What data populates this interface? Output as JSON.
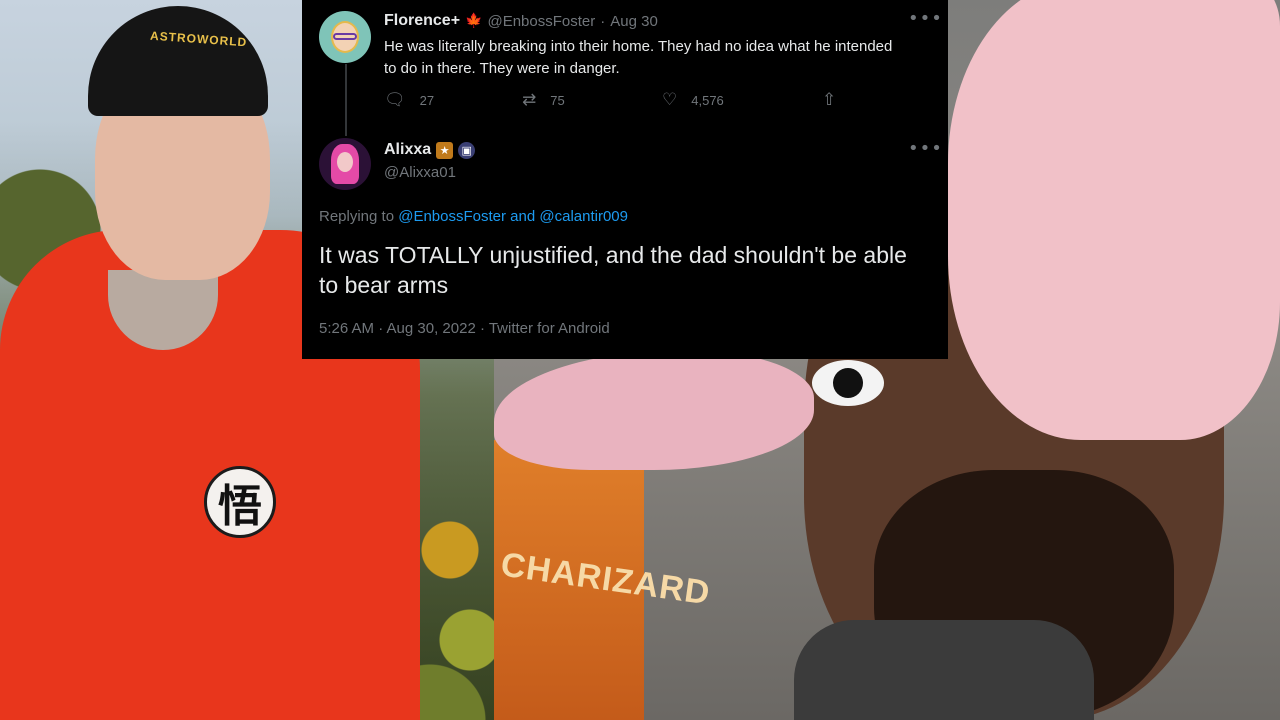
{
  "tweet_parent": {
    "display_name": "Florence+",
    "flag_icon": "maple-leaf-icon",
    "handle": "@EnbossFoster",
    "separator": "·",
    "date": "Aug 30",
    "text": "He was literally breaking into their home. They had no idea what he intended to do in there. They were in danger.",
    "more_icon": "more-options-icon",
    "actions": {
      "reply": {
        "icon": "reply-icon",
        "count": "27"
      },
      "retweet": {
        "icon": "retweet-icon",
        "count": "75"
      },
      "like": {
        "icon": "heart-icon",
        "count": "4,576"
      },
      "share": {
        "icon": "share-icon"
      }
    }
  },
  "tweet_main": {
    "display_name": "Alixxa",
    "badges": [
      "badge-emoji-icon",
      "badge-emoji-icon"
    ],
    "handle": "@Alixxa01",
    "replying_prefix": "Replying to",
    "reply_to_1": "@EnbossFoster",
    "reply_joiner": "and",
    "reply_to_2": "@calantir009",
    "text": "It was TOTALLY unjustified, and the dad shouldn't be able to bear arms",
    "timestamp": "5:26 AM · Aug 30, 2022 · Twitter for Android"
  },
  "background": {
    "cap_text": "ASTROWORLD",
    "hoodie_symbol": "悟",
    "box_text": "CHARIZARD"
  },
  "colors": {
    "tweet_bg": "#000000",
    "text_primary": "#e7e9ea",
    "text_secondary": "#71767b",
    "link": "#1d9bf0",
    "hoodie": "#e8361c",
    "hat": "#f1c1c8"
  }
}
